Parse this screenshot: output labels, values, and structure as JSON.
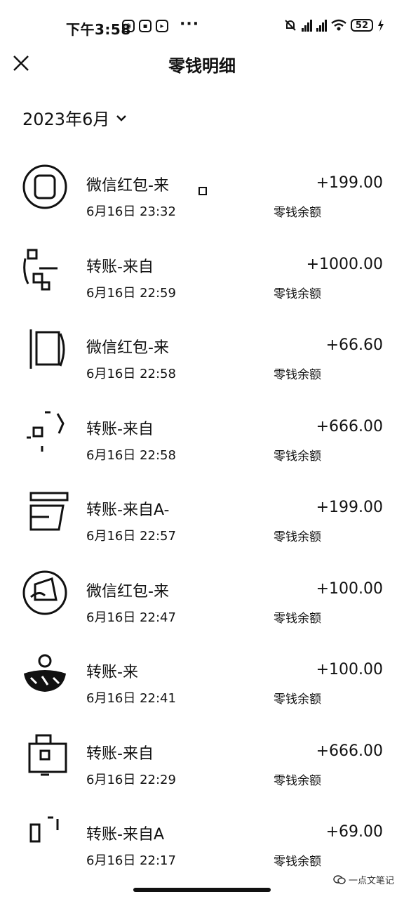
{
  "status": {
    "time": "下午3:58",
    "dots": "···",
    "battery": "52"
  },
  "header": {
    "title": "零钱明细"
  },
  "month": {
    "label": "2023年6月"
  },
  "balance_label": "零钱余额",
  "transactions": [
    {
      "title": "微信红包-来",
      "amount": "+199.00",
      "time": "6月16日 23:32"
    },
    {
      "title": "转账-来自",
      "amount": "+1000.00",
      "time": "6月16日 22:59"
    },
    {
      "title": "微信红包-来",
      "amount": "+66.60",
      "time": "6月16日 22:58"
    },
    {
      "title": "转账-来自",
      "amount": "+666.00",
      "time": "6月16日 22:58"
    },
    {
      "title": "转账-来自A-",
      "amount": "+199.00",
      "time": "6月16日 22:57"
    },
    {
      "title": "微信红包-来",
      "amount": "+100.00",
      "time": "6月16日 22:47"
    },
    {
      "title": "转账-来",
      "amount": "+100.00",
      "time": "6月16日 22:41"
    },
    {
      "title": "转账-来自",
      "amount": "+666.00",
      "time": "6月16日 22:29"
    },
    {
      "title": "转账-来自A",
      "amount": "+69.00",
      "time": "6月16日 22:17"
    }
  ],
  "watermark": "一点文笔记"
}
